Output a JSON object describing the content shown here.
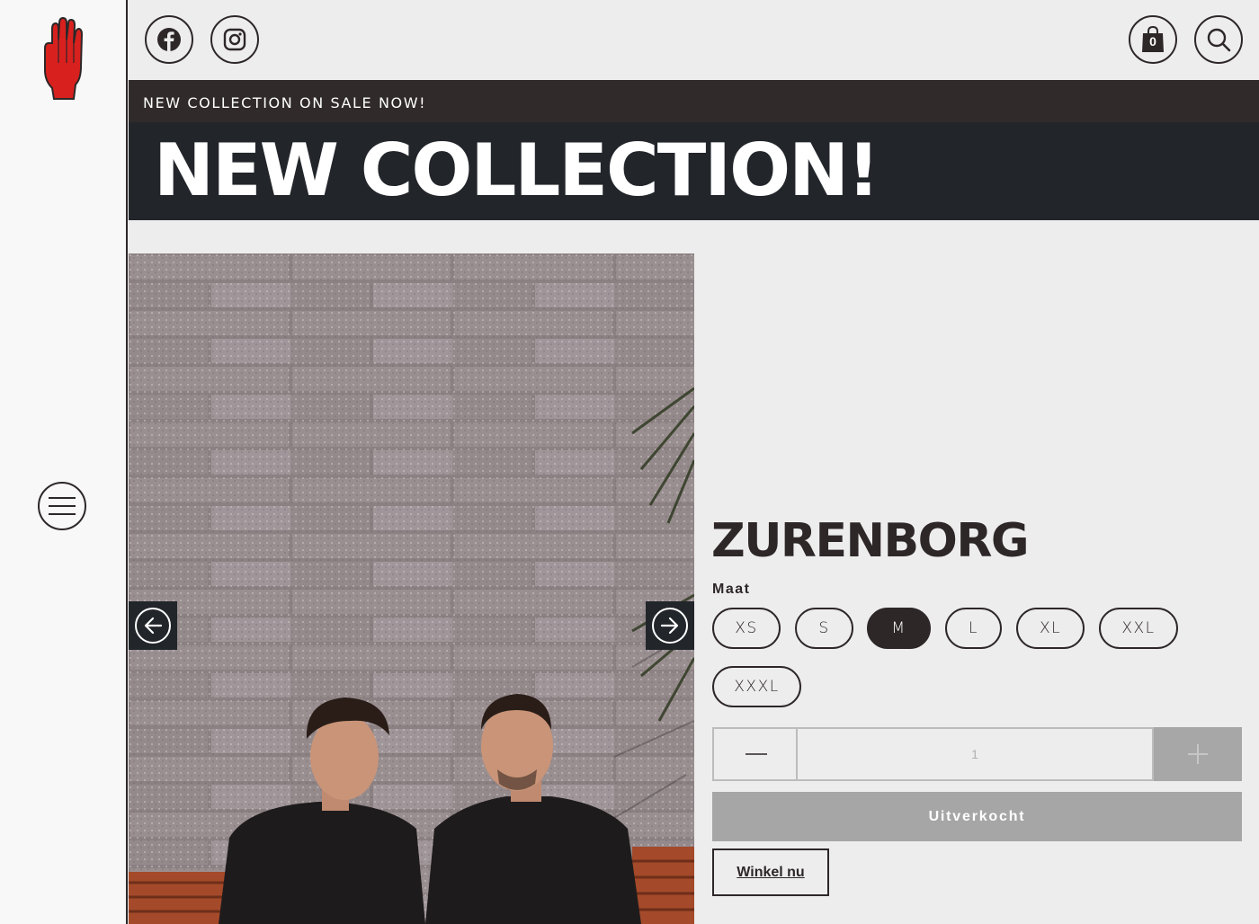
{
  "sidebar": {
    "logo": "red-hand-logo",
    "menu_icon": "hamburger-icon"
  },
  "header": {
    "social": [
      {
        "name": "facebook",
        "icon": "facebook-icon"
      },
      {
        "name": "instagram",
        "icon": "instagram-icon"
      }
    ],
    "cart_count": "0",
    "cart_icon": "shopping-bag-icon",
    "search_icon": "search-icon"
  },
  "announcement": {
    "text": "NEW COLLECTION ON SALE NOW!"
  },
  "hero": {
    "title": "NEW COLLECTION!"
  },
  "gallery": {
    "prev_icon": "arrow-left-icon",
    "next_icon": "arrow-right-icon"
  },
  "product": {
    "title": "ZURENBORG",
    "size_label": "Maat",
    "sizes": [
      "XS",
      "S",
      "M",
      "L",
      "XL",
      "XXL",
      "XXXL"
    ],
    "selected_size": "M",
    "quantity": "1",
    "soldout_label": "Uitverkocht",
    "shop_now_label": "Winkel nu"
  },
  "colors": {
    "dark": "#2d2728",
    "announcement_bg": "#302a2b",
    "hero_bg": "#22262b",
    "page_bg": "#eeedee",
    "disabled": "#a7a6a7",
    "logo_red": "#d8211e"
  }
}
